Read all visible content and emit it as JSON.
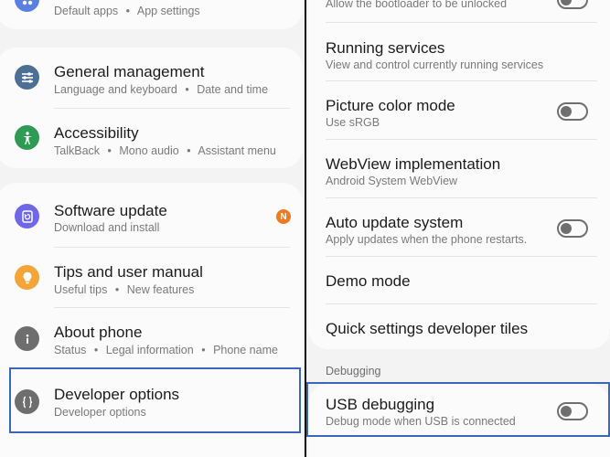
{
  "left": {
    "top_partial": {
      "subtitle_1": "Default apps",
      "subtitle_2": "App settings"
    },
    "general_management": {
      "title": "General management",
      "sub_1": "Language and keyboard",
      "sub_2": "Date and time"
    },
    "accessibility": {
      "title": "Accessibility",
      "sub_1": "TalkBack",
      "sub_2": "Mono audio",
      "sub_3": "Assistant menu"
    },
    "software_update": {
      "title": "Software update",
      "sub": "Download and install",
      "badge": "N"
    },
    "tips": {
      "title": "Tips and user manual",
      "sub_1": "Useful tips",
      "sub_2": "New features"
    },
    "about_phone": {
      "title": "About phone",
      "sub_1": "Status",
      "sub_2": "Legal information",
      "sub_3": "Phone name"
    },
    "developer_options": {
      "title": "Developer options",
      "sub": "Developer options"
    },
    "dot": "•"
  },
  "right": {
    "top_partial": {
      "subtitle": "Allow the bootloader to be unlocked"
    },
    "running_services": {
      "title": "Running services",
      "sub": "View and control currently running services"
    },
    "picture_color_mode": {
      "title": "Picture color mode",
      "sub": "Use sRGB",
      "toggle": "off"
    },
    "webview": {
      "title": "WebView implementation",
      "sub": "Android System WebView"
    },
    "auto_update": {
      "title": "Auto update system",
      "sub": "Apply updates when the phone restarts.",
      "toggle": "off"
    },
    "demo_mode": {
      "title": "Demo mode"
    },
    "quick_tiles": {
      "title": "Quick settings developer tiles"
    },
    "section_debugging": "Debugging",
    "usb_debugging": {
      "title": "USB debugging",
      "sub": "Debug mode when USB is connected",
      "toggle": "off"
    }
  },
  "colors": {
    "highlight": "#3c67b7",
    "general_management_icon": "#4c6f93",
    "accessibility_icon": "#2f9a53",
    "software_update_icon": "#6f66e8",
    "tips_icon": "#f3a53a",
    "about_phone_icon": "#6e6e6e",
    "developer_icon": "#6e6e6e",
    "badge": "#f07a22"
  },
  "icons": {
    "apps": "apps-icon",
    "general_management": "sliders-icon",
    "accessibility": "accessibility-icon",
    "software_update": "software-update-icon",
    "tips": "lightbulb-icon",
    "about_phone": "info-icon",
    "developer": "code-braces-icon"
  }
}
